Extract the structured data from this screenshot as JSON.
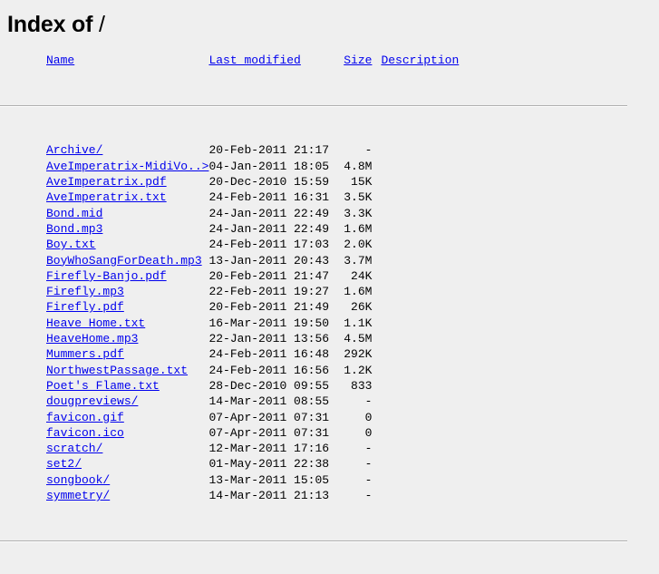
{
  "page": {
    "title_main": "Index of",
    "title_path": "/"
  },
  "columns": {
    "name": "Name",
    "last_modified": "Last modified",
    "size": "Size",
    "description": "Description"
  },
  "rows": [
    {
      "name": "Archive/",
      "last_modified": "20-Feb-2011 21:17",
      "size": "-",
      "description": ""
    },
    {
      "name": "AveImperatrix-MidiVo..>",
      "last_modified": "04-Jan-2011 18:05",
      "size": "4.8M",
      "description": ""
    },
    {
      "name": "AveImperatrix.pdf",
      "last_modified": "20-Dec-2010 15:59",
      "size": "15K",
      "description": ""
    },
    {
      "name": "AveImperatrix.txt",
      "last_modified": "24-Feb-2011 16:31",
      "size": "3.5K",
      "description": ""
    },
    {
      "name": "Bond.mid",
      "last_modified": "24-Jan-2011 22:49",
      "size": "3.3K",
      "description": ""
    },
    {
      "name": "Bond.mp3",
      "last_modified": "24-Jan-2011 22:49",
      "size": "1.6M",
      "description": ""
    },
    {
      "name": "Boy.txt",
      "last_modified": "24-Feb-2011 17:03",
      "size": "2.0K",
      "description": ""
    },
    {
      "name": "BoyWhoSangForDeath.mp3",
      "last_modified": "13-Jan-2011 20:43",
      "size": "3.7M",
      "description": ""
    },
    {
      "name": "Firefly-Banjo.pdf",
      "last_modified": "20-Feb-2011 21:47",
      "size": "24K",
      "description": ""
    },
    {
      "name": "Firefly.mp3",
      "last_modified": "22-Feb-2011 19:27",
      "size": "1.6M",
      "description": ""
    },
    {
      "name": "Firefly.pdf",
      "last_modified": "20-Feb-2011 21:49",
      "size": "26K",
      "description": ""
    },
    {
      "name": "Heave Home.txt",
      "last_modified": "16-Mar-2011 19:50",
      "size": "1.1K",
      "description": ""
    },
    {
      "name": "HeaveHome.mp3",
      "last_modified": "22-Jan-2011 13:56",
      "size": "4.5M",
      "description": ""
    },
    {
      "name": "Mummers.pdf",
      "last_modified": "24-Feb-2011 16:48",
      "size": "292K",
      "description": ""
    },
    {
      "name": "NorthwestPassage.txt",
      "last_modified": "24-Feb-2011 16:56",
      "size": "1.2K",
      "description": ""
    },
    {
      "name": "Poet's Flame.txt",
      "last_modified": "28-Dec-2010 09:55",
      "size": "833",
      "description": ""
    },
    {
      "name": "dougpreviews/",
      "last_modified": "14-Mar-2011 08:55",
      "size": "-",
      "description": ""
    },
    {
      "name": "favicon.gif",
      "last_modified": "07-Apr-2011 07:31",
      "size": "0",
      "description": ""
    },
    {
      "name": "favicon.ico",
      "last_modified": "07-Apr-2011 07:31",
      "size": "0",
      "description": ""
    },
    {
      "name": "scratch/",
      "last_modified": "12-Mar-2011 17:16",
      "size": "-",
      "description": ""
    },
    {
      "name": "set2/",
      "last_modified": "01-May-2011 22:38",
      "size": "-",
      "description": ""
    },
    {
      "name": "songbook/",
      "last_modified": "13-Mar-2011 15:05",
      "size": "-",
      "description": ""
    },
    {
      "name": "symmetry/",
      "last_modified": "14-Mar-2011 21:13",
      "size": "-",
      "description": ""
    }
  ],
  "colors": {
    "link": "#0000ee",
    "text": "#000000",
    "background": "#efefef",
    "rule": "#b0b0b0"
  }
}
